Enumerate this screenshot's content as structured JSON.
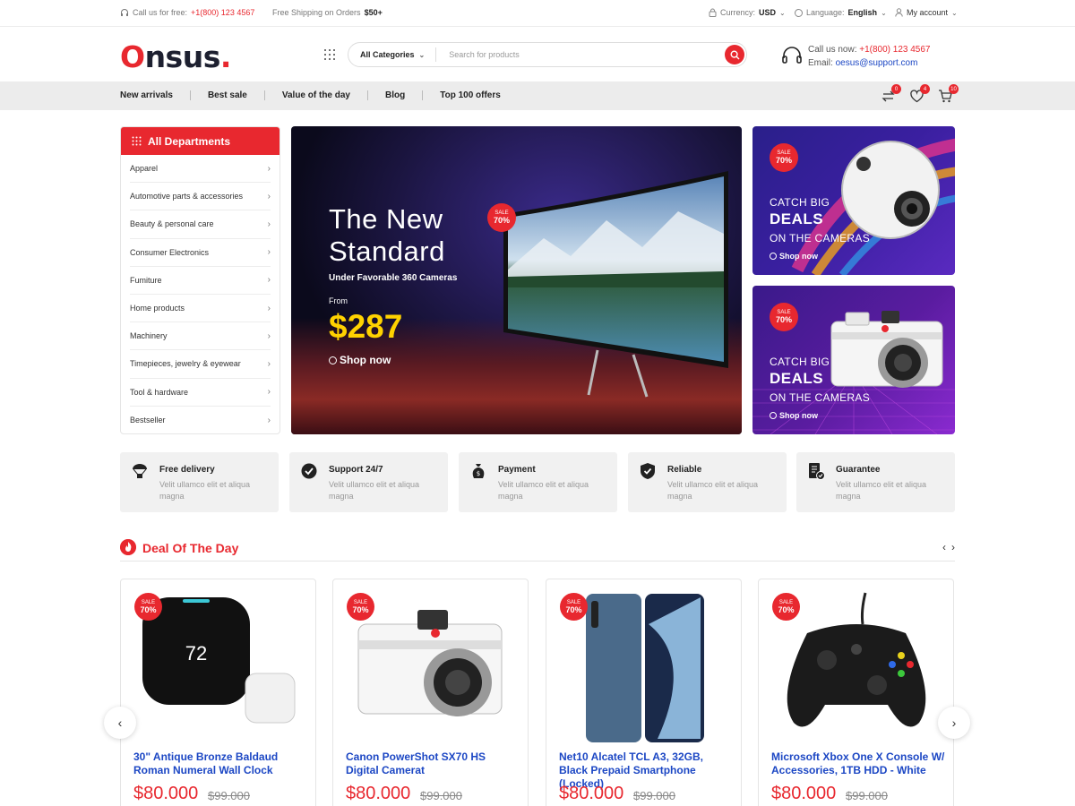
{
  "topbar": {
    "call_label": "Call us for free:",
    "call_number": "+1(800) 123 4567",
    "shipping_label": "Free Shipping on Orders",
    "shipping_value": "$50+",
    "currency_label": "Currency:",
    "currency_value": "USD",
    "language_label": "Language:",
    "language_value": "English",
    "account_label": "My account"
  },
  "header": {
    "logo_first": "O",
    "logo_rest": "nsus",
    "logo_dot": ".",
    "categories_label": "All Categories",
    "search_placeholder": "Search for products",
    "call_now_label": "Call us now:",
    "call_now_number": "+1(800) 123 4567",
    "email_label": "Email:",
    "email_value": "oesus@support.com"
  },
  "nav": {
    "links": [
      "New arrivals",
      "Best sale",
      "Value of the day",
      "Blog",
      "Top 100 offers"
    ],
    "compare_count": "0",
    "wishlist_count": "4",
    "cart_count": "10"
  },
  "departments": {
    "title": "All Departments",
    "items": [
      "Apparel",
      "Automotive parts &  accessories",
      "Beauty & personal care",
      "Consumer Electronics",
      "Fumiture",
      "Home products",
      "Machinery",
      "Timepieces, jewelry & eyewear",
      "Tool & hardware",
      "Bestseller"
    ]
  },
  "hero": {
    "title_line1": "The New",
    "title_line2": "Standard",
    "subtitle": "Under Favorable 360 Cameras",
    "from_label": "From",
    "price": "$287",
    "cta": "Shop now",
    "sale_label": "SALE",
    "sale_value": "70%"
  },
  "promos": [
    {
      "line1": "CATCH BIG",
      "line2": "DEALS",
      "line3": "ON THE CAMERAS",
      "cta": "Shop now",
      "sale_label": "SALE",
      "sale_value": "70%"
    },
    {
      "line1": "CATCH BIG",
      "line2": "DEALS",
      "line3": "ON THE CAMERAS",
      "cta": "Shop now",
      "sale_label": "SALE",
      "sale_value": "70%"
    }
  ],
  "features": [
    {
      "title": "Free delivery",
      "desc": "Velit ullamco elit et aliqua magna",
      "icon": "parachute-icon"
    },
    {
      "title": "Support 24/7",
      "desc": "Velit ullamco elit et aliqua magna",
      "icon": "badge-check-icon"
    },
    {
      "title": "Payment",
      "desc": "Velit ullamco elit et aliqua magna",
      "icon": "money-bag-icon"
    },
    {
      "title": "Reliable",
      "desc": "Velit ullamco elit et aliqua magna",
      "icon": "shield-check-icon"
    },
    {
      "title": "Guarantee",
      "desc": "Velit ullamco elit et aliqua magna",
      "icon": "document-check-icon"
    }
  ],
  "deal": {
    "title": "Deal Of The Day",
    "products": [
      {
        "name": "30\" Antique Bronze Baldaud Roman Numeral Wall Clock",
        "price": "$80.000",
        "old_price": "$99.000",
        "sale_label": "SALE",
        "sale_value": "70%",
        "display_value": "72"
      },
      {
        "name": "Canon PowerShot SX70 HS Digital Camerat",
        "price": "$80.000",
        "old_price": "$99.000",
        "sale_label": "SALE",
        "sale_value": "70%"
      },
      {
        "name": "Net10 Alcatel TCL A3, 32GB, Black Prepaid Smartphone (Locked)",
        "price": "$80.000",
        "old_price": "$99.000",
        "sale_label": "SALE",
        "sale_value": "70%"
      },
      {
        "name": "Microsoft Xbox One X Console W/ Accessories, 1TB HDD - White",
        "price": "$80.000",
        "old_price": "$99.000",
        "sale_label": "SALE",
        "sale_value": "70%"
      }
    ]
  },
  "colors": {
    "accent": "#e8282f",
    "link_blue": "#1c47c4",
    "price_yellow": "#ffd200"
  }
}
